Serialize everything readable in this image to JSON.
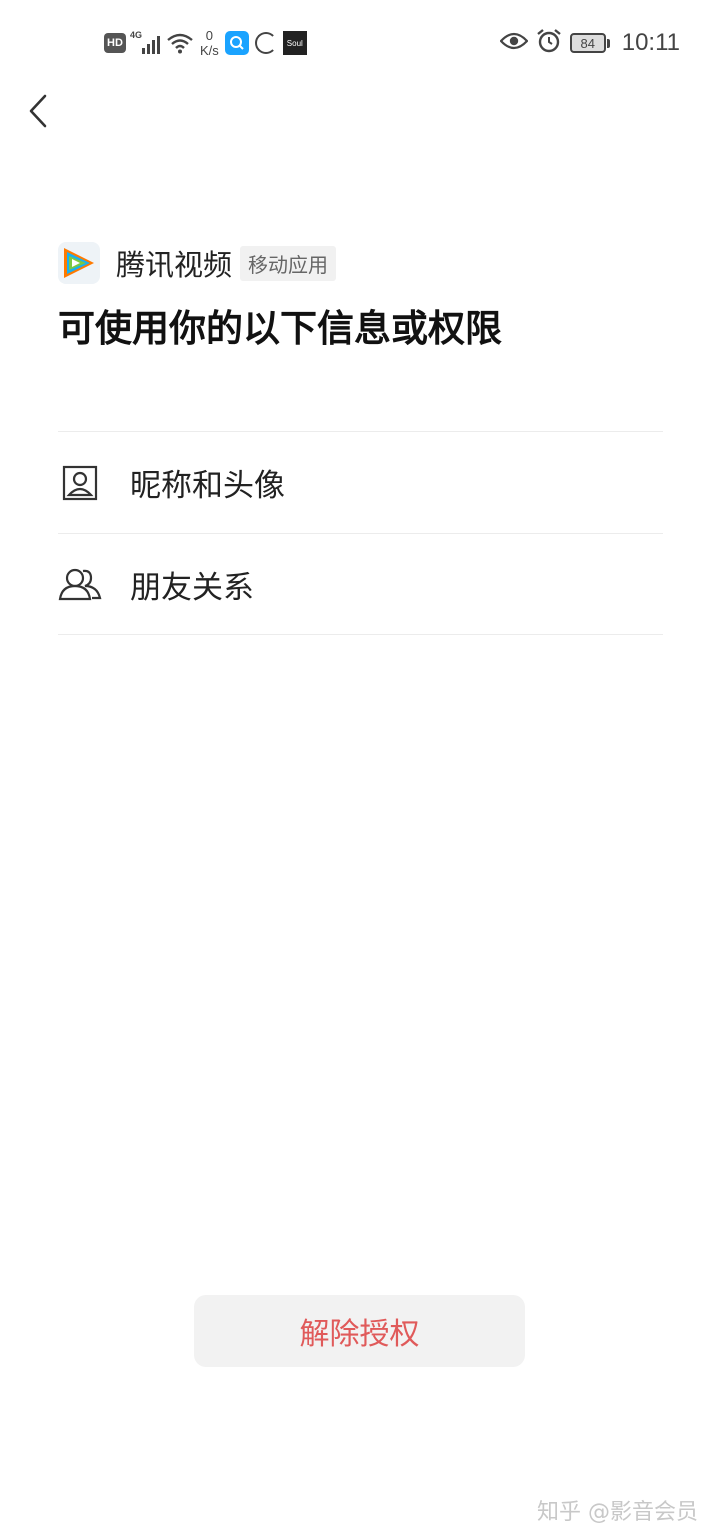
{
  "status_bar": {
    "hd": "HD",
    "network": "4G",
    "speed_value": "0",
    "speed_unit": "K/s",
    "soul_label": "Soul",
    "battery": "84",
    "time": "10:11"
  },
  "app": {
    "name": "腾讯视频",
    "tag": "移动应用"
  },
  "title": "可使用你的以下信息或权限",
  "permissions": [
    {
      "label": "昵称和头像",
      "icon": "profile-card-icon"
    },
    {
      "label": "朋友关系",
      "icon": "friends-icon"
    }
  ],
  "revoke_button": "解除授权",
  "watermark": "知乎 @影音会员",
  "colors": {
    "revoke_text": "#e05a5a",
    "button_bg": "#f2f2f2"
  }
}
